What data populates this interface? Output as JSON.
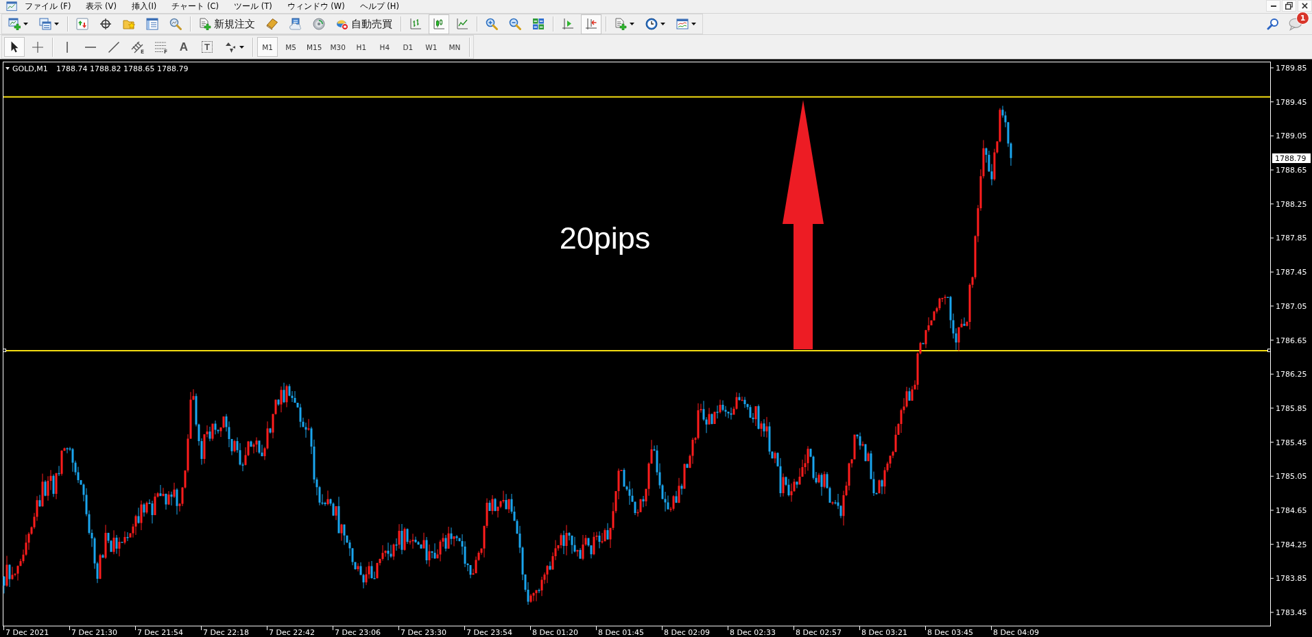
{
  "menu_bar": {
    "items": [
      "ファイル (F)",
      "表示 (V)",
      "挿入(I)",
      "チャート (C)",
      "ツール (T)",
      "ウィンドウ (W)",
      "ヘルプ (H)"
    ]
  },
  "main_toolbar": {
    "groups": [
      [
        {
          "kind": "dropdown",
          "pressed": false
        },
        {
          "kind": "dropdown",
          "pressed": false
        }
      ],
      [
        {
          "kind": "icon",
          "pressed": false
        },
        {
          "kind": "icon",
          "pressed": false
        },
        {
          "kind": "icon",
          "pressed": false
        },
        {
          "kind": "icon",
          "pressed": false
        },
        {
          "kind": "icon",
          "pressed": false
        }
      ],
      [
        {
          "kind": "labeled",
          "label": "新規注文",
          "pressed": false
        },
        {
          "kind": "icon",
          "pressed": false
        },
        {
          "kind": "icon",
          "pressed": false
        },
        {
          "kind": "icon",
          "pressed": false
        },
        {
          "kind": "labeled",
          "label": "自動売買",
          "pressed": false
        }
      ],
      [
        {
          "kind": "icon",
          "pressed": false
        },
        {
          "kind": "icon",
          "pressed": true
        },
        {
          "kind": "icon",
          "pressed": false
        }
      ],
      [
        {
          "kind": "icon",
          "pressed": false
        },
        {
          "kind": "icon",
          "pressed": false
        },
        {
          "kind": "icon",
          "pressed": false
        }
      ],
      [
        {
          "kind": "icon",
          "pressed": false
        },
        {
          "kind": "icon",
          "pressed": true
        }
      ],
      [
        {
          "kind": "dropdown",
          "pressed": false
        },
        {
          "kind": "dropdown",
          "pressed": false
        },
        {
          "kind": "dropdown",
          "pressed": false
        }
      ]
    ]
  },
  "notifications": {
    "badge": "1"
  },
  "drawing_toolbar": {
    "groups": [
      [
        {
          "kind": "icon",
          "pressed": true
        },
        {
          "kind": "icon",
          "pressed": false
        }
      ],
      [
        {
          "kind": "icon",
          "pressed": false
        },
        {
          "kind": "icon",
          "pressed": false
        },
        {
          "kind": "icon",
          "pressed": false
        },
        {
          "kind": "icon",
          "sub": "E",
          "pressed": false
        },
        {
          "kind": "icon",
          "sub": "F",
          "pressed": false
        },
        {
          "kind": "glyph",
          "label": "A",
          "pressed": false
        },
        {
          "kind": "boxed_glyph",
          "label": "T",
          "pressed": false
        },
        {
          "kind": "dropdown",
          "pressed": false
        }
      ]
    ]
  },
  "timeframes": [
    {
      "label": "M1",
      "selected": true
    },
    {
      "label": "M5",
      "selected": false
    },
    {
      "label": "M15",
      "selected": false
    },
    {
      "label": "M30",
      "selected": false
    },
    {
      "label": "H1",
      "selected": false
    },
    {
      "label": "H4",
      "selected": false
    },
    {
      "label": "D1",
      "selected": false
    },
    {
      "label": "W1",
      "selected": false
    },
    {
      "label": "MN",
      "selected": false
    }
  ],
  "chart": {
    "symbol": "GOLD,M1",
    "quotes": "1788.74 1788.82 1788.65 1788.79",
    "annotation": "20pips",
    "current_price": "1788.79",
    "price_labels": [
      "1789.85",
      "1789.45",
      "1789.05",
      "1788.65",
      "1788.25",
      "1787.85",
      "1787.45",
      "1787.05",
      "1786.65",
      "1786.25",
      "1785.85",
      "1785.45",
      "1785.05",
      "1784.65",
      "1784.25",
      "1783.85",
      "1783.45"
    ],
    "time_labels": [
      "7 Dec 2021",
      "7 Dec 21:30",
      "7 Dec 21:54",
      "7 Dec 22:18",
      "7 Dec 22:42",
      "7 Dec 23:06",
      "7 Dec 23:30",
      "7 Dec 23:54",
      "8 Dec 01:20",
      "8 Dec 01:45",
      "8 Dec 02:09",
      "8 Dec 02:33",
      "8 Dec 02:57",
      "8 Dec 03:21",
      "8 Dec 03:45",
      "8 Dec 04:09"
    ]
  }
}
